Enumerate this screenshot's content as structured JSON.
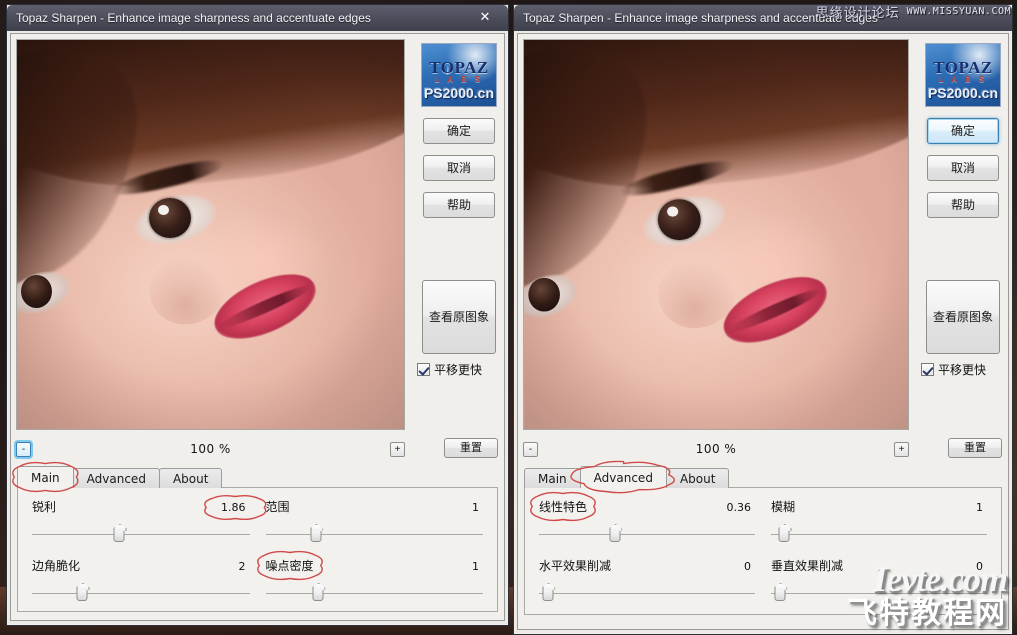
{
  "window_title": "Topaz Sharpen - Enhance image sharpness and accentuate edges",
  "close_label": "✕",
  "watermarks": {
    "top_cn": "思缘设计论坛",
    "top_url": "WWW.MISSYUAN.COM",
    "bottom_site": "Ievte.com",
    "bottom_cn": "飞特教程网"
  },
  "logo": {
    "top": "TOPAZ",
    "sub": "L A B S",
    "cn": "PS2000.cn"
  },
  "sidebar": {
    "ok_label": "确定",
    "cancel_label": "取消",
    "help_label": "帮助",
    "view_original_label": "查看原图象",
    "pan_fast_label": "平移更快",
    "pan_fast_checked": true
  },
  "zoom": {
    "minus_label": "-",
    "plus_label": "+",
    "value": "100 %",
    "reset_label": "重置"
  },
  "tabs": {
    "main": "Main",
    "advanced": "Advanced",
    "about": "About"
  },
  "left_window": {
    "active_tab": "Main",
    "controls": [
      {
        "label": "锐利",
        "value": "1.86",
        "pos": 40,
        "annotated_value": true,
        "annotated_label": false
      },
      {
        "label": "范围",
        "value": "1",
        "pos": 23,
        "annotated_value": false,
        "annotated_label": false
      },
      {
        "label": "边角脆化",
        "value": "2",
        "pos": 23,
        "annotated_value": false,
        "annotated_label": false
      },
      {
        "label": "噪点密度",
        "value": "1",
        "pos": 24,
        "annotated_value": false,
        "annotated_label": true
      }
    ]
  },
  "right_window": {
    "active_tab": "Advanced",
    "controls": [
      {
        "label": "线性特色",
        "value": "0.36",
        "pos": 35,
        "annotated_value": false,
        "annotated_label": true
      },
      {
        "label": "模糊",
        "value": "1",
        "pos": 6,
        "annotated_value": false,
        "annotated_label": false
      },
      {
        "label": "水平效果削减",
        "value": "0",
        "pos": 4,
        "annotated_value": false,
        "annotated_label": false
      },
      {
        "label": "垂直效果削减",
        "value": "0",
        "pos": 4,
        "annotated_value": false,
        "annotated_label": false
      }
    ]
  },
  "colors": {
    "annotation": "#d04a4a",
    "titlebar": "#4c4e5c",
    "panel_bg": "#f2f1ee",
    "focus_blue": "#3c7fb1"
  }
}
